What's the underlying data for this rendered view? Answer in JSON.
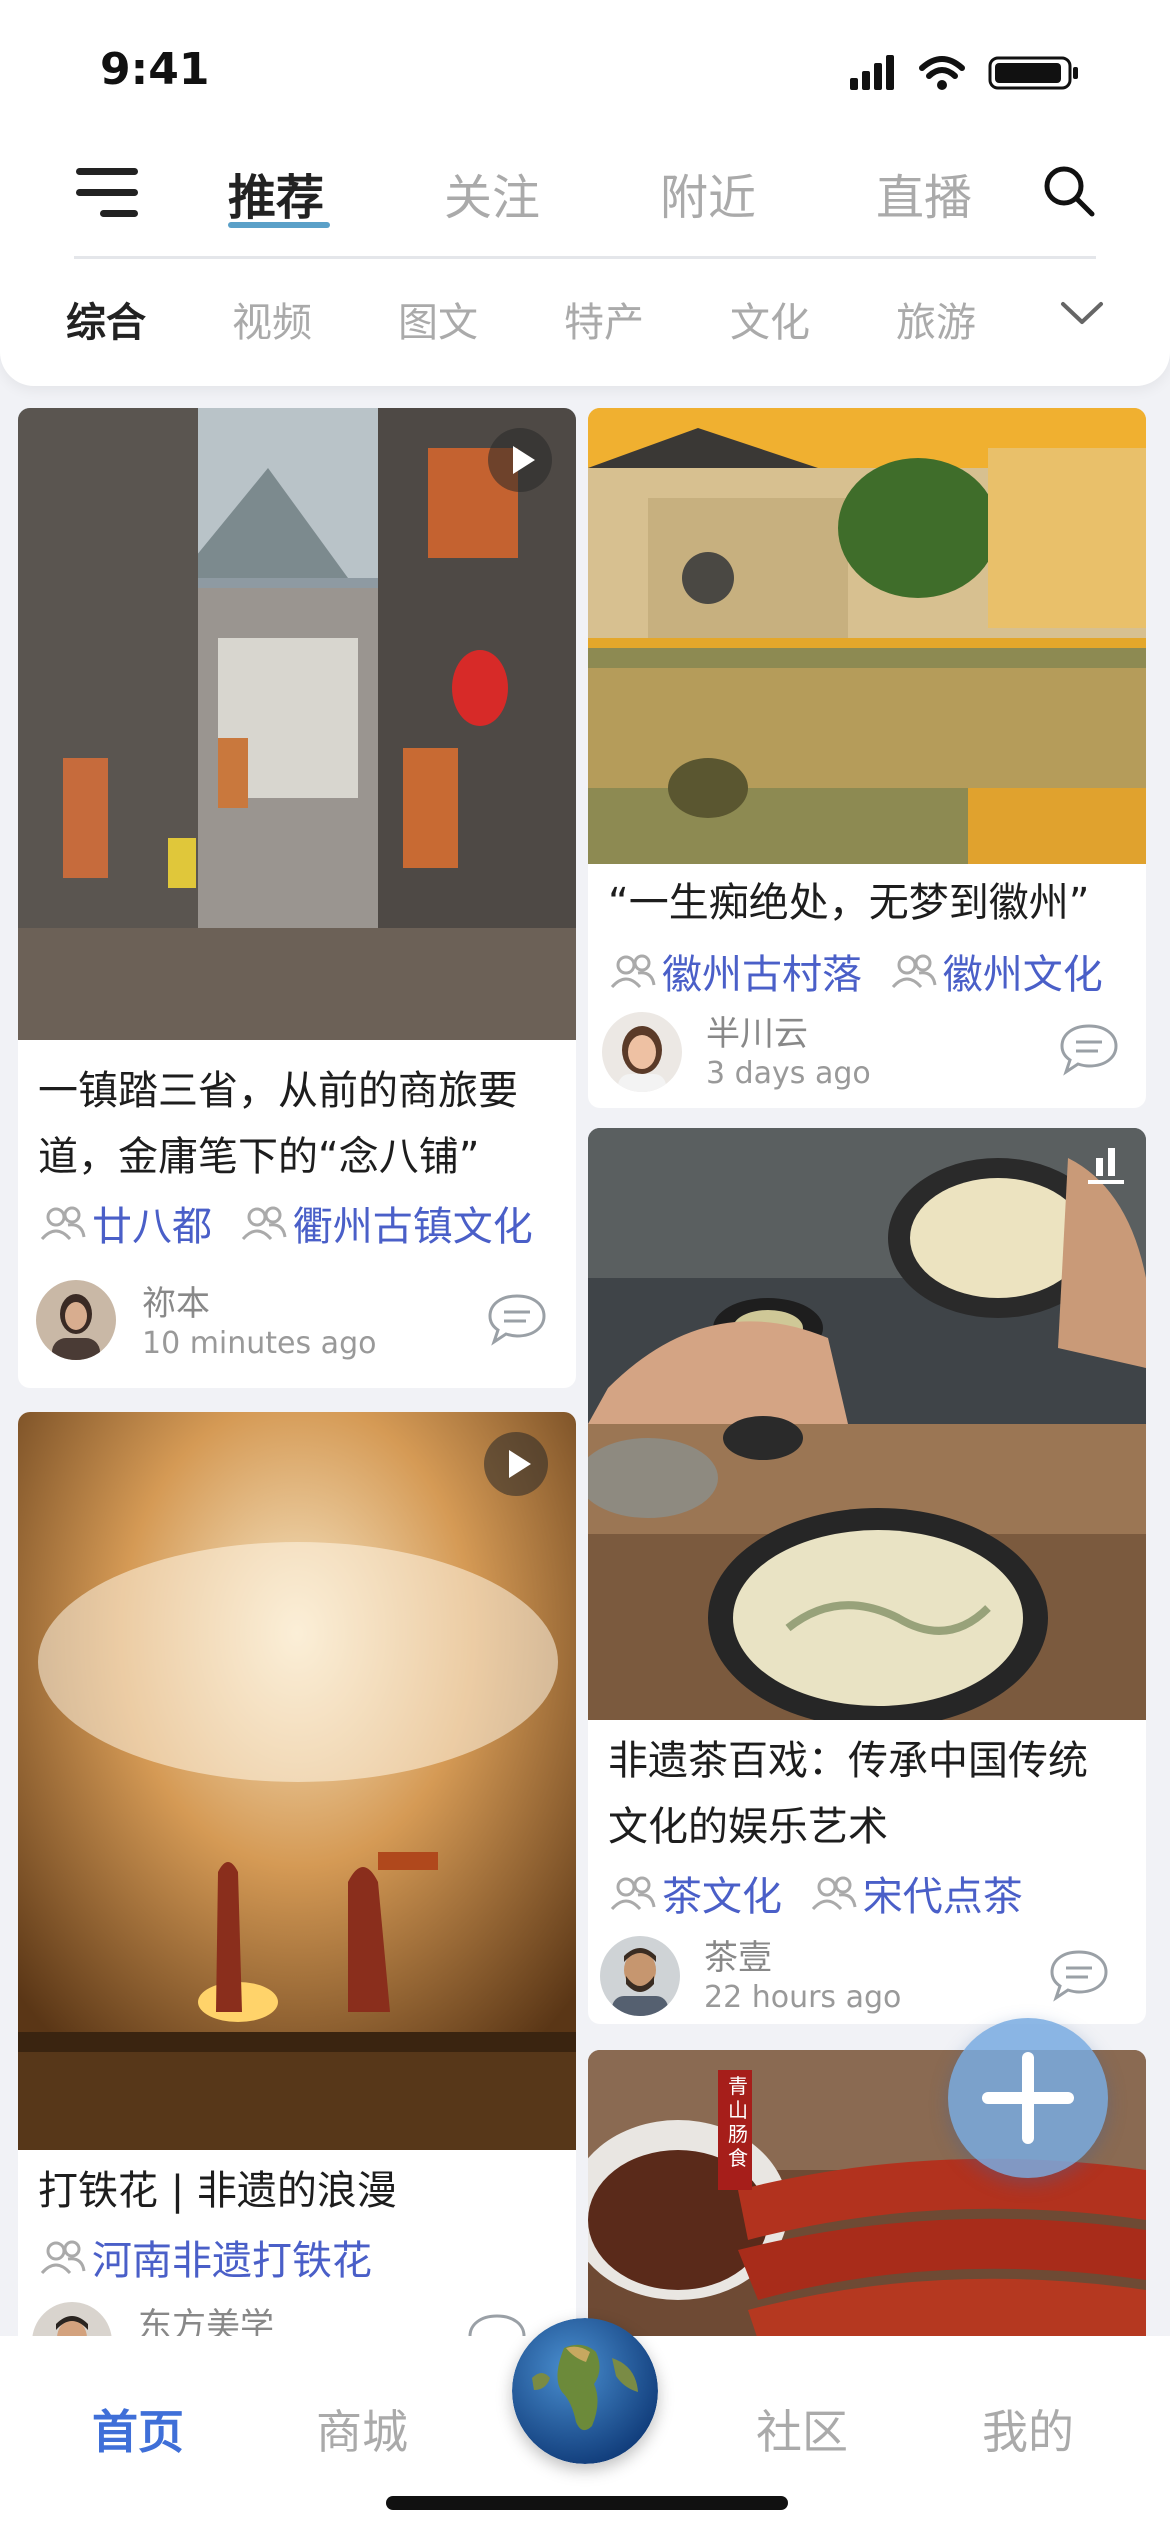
{
  "status_bar": {
    "time": "9:41"
  },
  "top_tabs": [
    {
      "label": "推荐",
      "active": true
    },
    {
      "label": "关注",
      "active": false
    },
    {
      "label": "附近",
      "active": false
    },
    {
      "label": "直播",
      "active": false
    }
  ],
  "categories": [
    {
      "label": "综合",
      "active": true
    },
    {
      "label": "视频",
      "active": false
    },
    {
      "label": "图文",
      "active": false
    },
    {
      "label": "特产",
      "active": false
    },
    {
      "label": "文化",
      "active": false
    },
    {
      "label": "旅游",
      "active": false
    }
  ],
  "cards": {
    "c1": {
      "title_line1": "一镇踏三省，从前的商旅要",
      "title_line2": "道，金庸笔下的“念八铺”",
      "tags": [
        "廿八都",
        "衢州古镇文化"
      ],
      "author": "祢本",
      "time_ago": "10 minutes ago",
      "media": "video"
    },
    "c2": {
      "title": "“一生痴绝处，无梦到徽州”",
      "tags": [
        "徽州古村落",
        "徽州文化"
      ],
      "author": "半川云",
      "time_ago": "3 days ago"
    },
    "c3": {
      "title_line1": "非遗茶百戏：传承中国传统",
      "title_line2": "文化的娱乐艺术",
      "tags": [
        "茶文化",
        "宋代点茶"
      ],
      "author": "茶壹",
      "time_ago": "22 hours ago"
    },
    "c4": {
      "title": "打铁花 | 非遗的浪漫",
      "tags": [
        "河南非遗打铁花"
      ],
      "author": "东方美学",
      "media": "video"
    },
    "c5": {
      "seal_text": "青山肠食"
    }
  },
  "bottom_nav": [
    {
      "label": "首页",
      "active": true
    },
    {
      "label": "商城",
      "active": false
    },
    {
      "label": "社区",
      "active": false
    },
    {
      "label": "我的",
      "active": false
    }
  ],
  "colors": {
    "accent": "#3f6fd8",
    "tag": "#4a5fc8",
    "tab_underline": "#5aa0c8"
  }
}
